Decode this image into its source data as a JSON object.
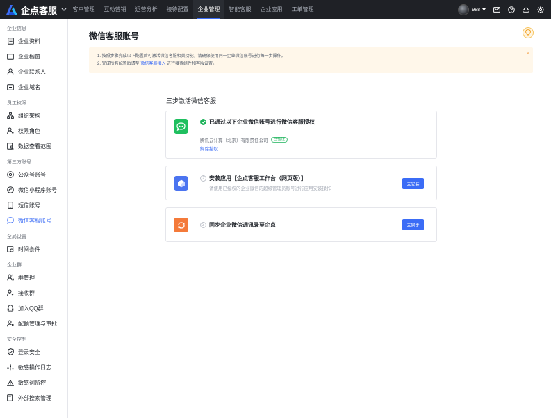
{
  "app": {
    "logo_text": "企点客服"
  },
  "nav": {
    "items": [
      "客户管理",
      "互动营销",
      "运营分析",
      "接待配置",
      "企业管理",
      "智能客服",
      "企业应用",
      "工单管理"
    ],
    "active_index": 4
  },
  "user": {
    "name": "988"
  },
  "sidebar": {
    "groups": [
      {
        "title": "企业信息",
        "items": [
          "企业资料",
          "企业橱窗",
          "企业联系人",
          "企业域名"
        ]
      },
      {
        "title": "员工权限",
        "items": [
          "组织架构",
          "权限角色",
          "数据查看范围"
        ]
      },
      {
        "title": "第三方账号",
        "items": [
          "公众号账号",
          "微信小程序账号",
          "短信账号",
          "微信客服账号"
        ]
      },
      {
        "title": "全局设置",
        "items": [
          "时间条件"
        ]
      },
      {
        "title": "企业群",
        "items": [
          "群管理",
          "接收群",
          "加入QQ群",
          "配额管理与审批"
        ]
      },
      {
        "title": "安全控制",
        "items": [
          "登录安全",
          "敏感操作日志",
          "敏感词监控",
          "外部搜索管理"
        ]
      }
    ],
    "active_item": "微信客服账号"
  },
  "main": {
    "title": "微信客服账号",
    "notice": {
      "line1": "1. 按照步骤完成以下配置后可激活微信客服相关功能，请确保使用同一企业微信账号进行每一步操作。",
      "line2_prefix": "2. 完成所有配置后请至",
      "line2_link": "微信客服接入",
      "line2_suffix": "进行接待组件和客服设置。",
      "close": "×"
    },
    "steps_title": "三步激活微信客服",
    "step1": {
      "title": "已通过以下企业微信账号进行微信客服授权",
      "company": "腾讯云计算（北京）有限责任公司",
      "badge": "已验证",
      "revoke": "解除授权"
    },
    "step2": {
      "num": "2",
      "title": "安装应用【企点客服工作台（网页版）】",
      "desc": "请使用已授权的企业微信的超级管理员账号进行应用安装操作",
      "button": "去安装"
    },
    "step3": {
      "num": "3",
      "title": "同步企业微信通讯录至企点",
      "button": "去同步"
    }
  },
  "colors": {
    "accent": "#3b6cf6",
    "topbar": "#1f2126",
    "success": "#1fb35b",
    "wechat": "#1fbf5f",
    "install": "#4b74f0",
    "sync": "#f47a3a"
  }
}
